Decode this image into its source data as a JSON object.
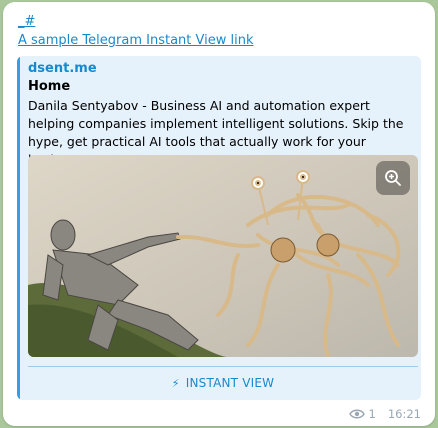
{
  "message": {
    "link_text": "_#",
    "subtitle": "A sample Telegram Instant View link",
    "views": "1",
    "time": "16:21"
  },
  "preview": {
    "site_name": "dsent.me",
    "title": "Home",
    "description": "Danila Sentyabov - Business AI and automation expert helping companies implement intelligent solutions. Skip the hype, get practical AI tools that actually work for your business.",
    "instant_view_label": "INSTANT VIEW",
    "image_icon": "zoom-in-icon"
  },
  "colors": {
    "accent": "#168acd",
    "preview_bg": "#e6f2fb",
    "chat_bg": "#a9c79a"
  }
}
